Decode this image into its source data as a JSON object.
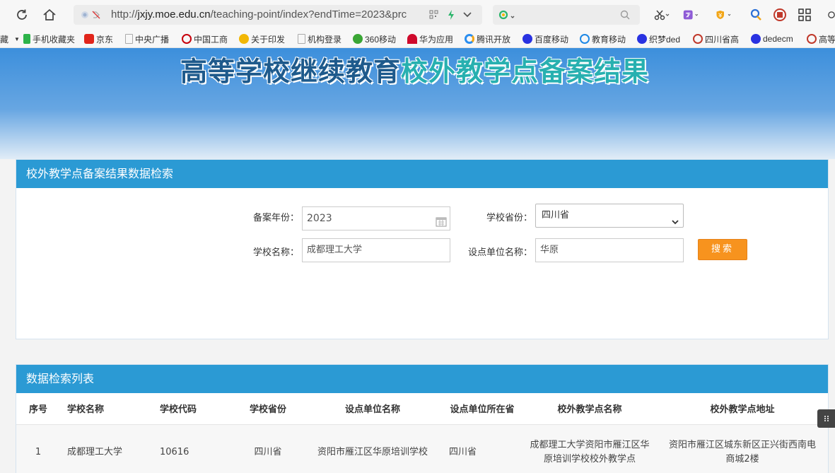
{
  "browser": {
    "url_prefix": "http://",
    "url_domain": "jxjy.moe.edu.cn",
    "url_path": "/teaching-point/index?endTime=2023&prc",
    "bookmarks": [
      {
        "label": "藏",
        "color": "#777"
      },
      {
        "label": "手机收藏夹",
        "color": "#2db34a"
      },
      {
        "label": "京东",
        "color": "#e1251b"
      },
      {
        "label": "中央广播",
        "color": "#bbb"
      },
      {
        "label": "中国工商",
        "color": "#c7000b"
      },
      {
        "label": "关于印发",
        "color": "#f2b705"
      },
      {
        "label": "机构登录",
        "color": "#bbb"
      },
      {
        "label": "360移动",
        "color": "#3aa635"
      },
      {
        "label": "华为应用",
        "color": "#cf0a2c"
      },
      {
        "label": "腾讯开放",
        "color": "#2a8ef0"
      },
      {
        "label": "百度移动",
        "color": "#2932e1"
      },
      {
        "label": "教育移动",
        "color": "#1e88e5"
      },
      {
        "label": "织梦ded",
        "color": "#2932e1"
      },
      {
        "label": "四川省高",
        "color": "#c0392b"
      },
      {
        "label": "dedecm",
        "color": "#2932e1"
      },
      {
        "label": "高等",
        "color": "#c0392b"
      }
    ]
  },
  "banner": {
    "title_part1": "高等学校继续教育",
    "title_part2": "校外教学点备案结果"
  },
  "search_panel": {
    "title": "校外教学点备案结果数据检索",
    "year_label": "备案年份：",
    "year_value": "2023",
    "province_label": "学校省份：",
    "province_value": "四川省",
    "school_label": "学校名称：",
    "school_value": "成都理工大学",
    "unit_label": "设点单位名称：",
    "unit_value": "华原",
    "search_button": "搜索"
  },
  "results_panel": {
    "title": "数据检索列表",
    "columns": [
      "序号",
      "学校名称",
      "学校代码",
      "学校省份",
      "设点单位名称",
      "设点单位所在省",
      "校外教学点名称",
      "校外教学点地址"
    ],
    "rows": [
      [
        "1",
        "成都理工大学",
        "10616",
        "四川省",
        "资阳市雁江区华原培训学校",
        "四川省",
        "成都理工大学资阳市雁江区华原培训学校校外教学点",
        "资阳市雁江区城东新区正兴街西南电商城2楼"
      ]
    ]
  },
  "colors": {
    "header_blue": "#2b9ad4",
    "search_orange": "#f7931e",
    "title_dark": "#1e5a8c",
    "title_teal": "#27b0b0"
  }
}
